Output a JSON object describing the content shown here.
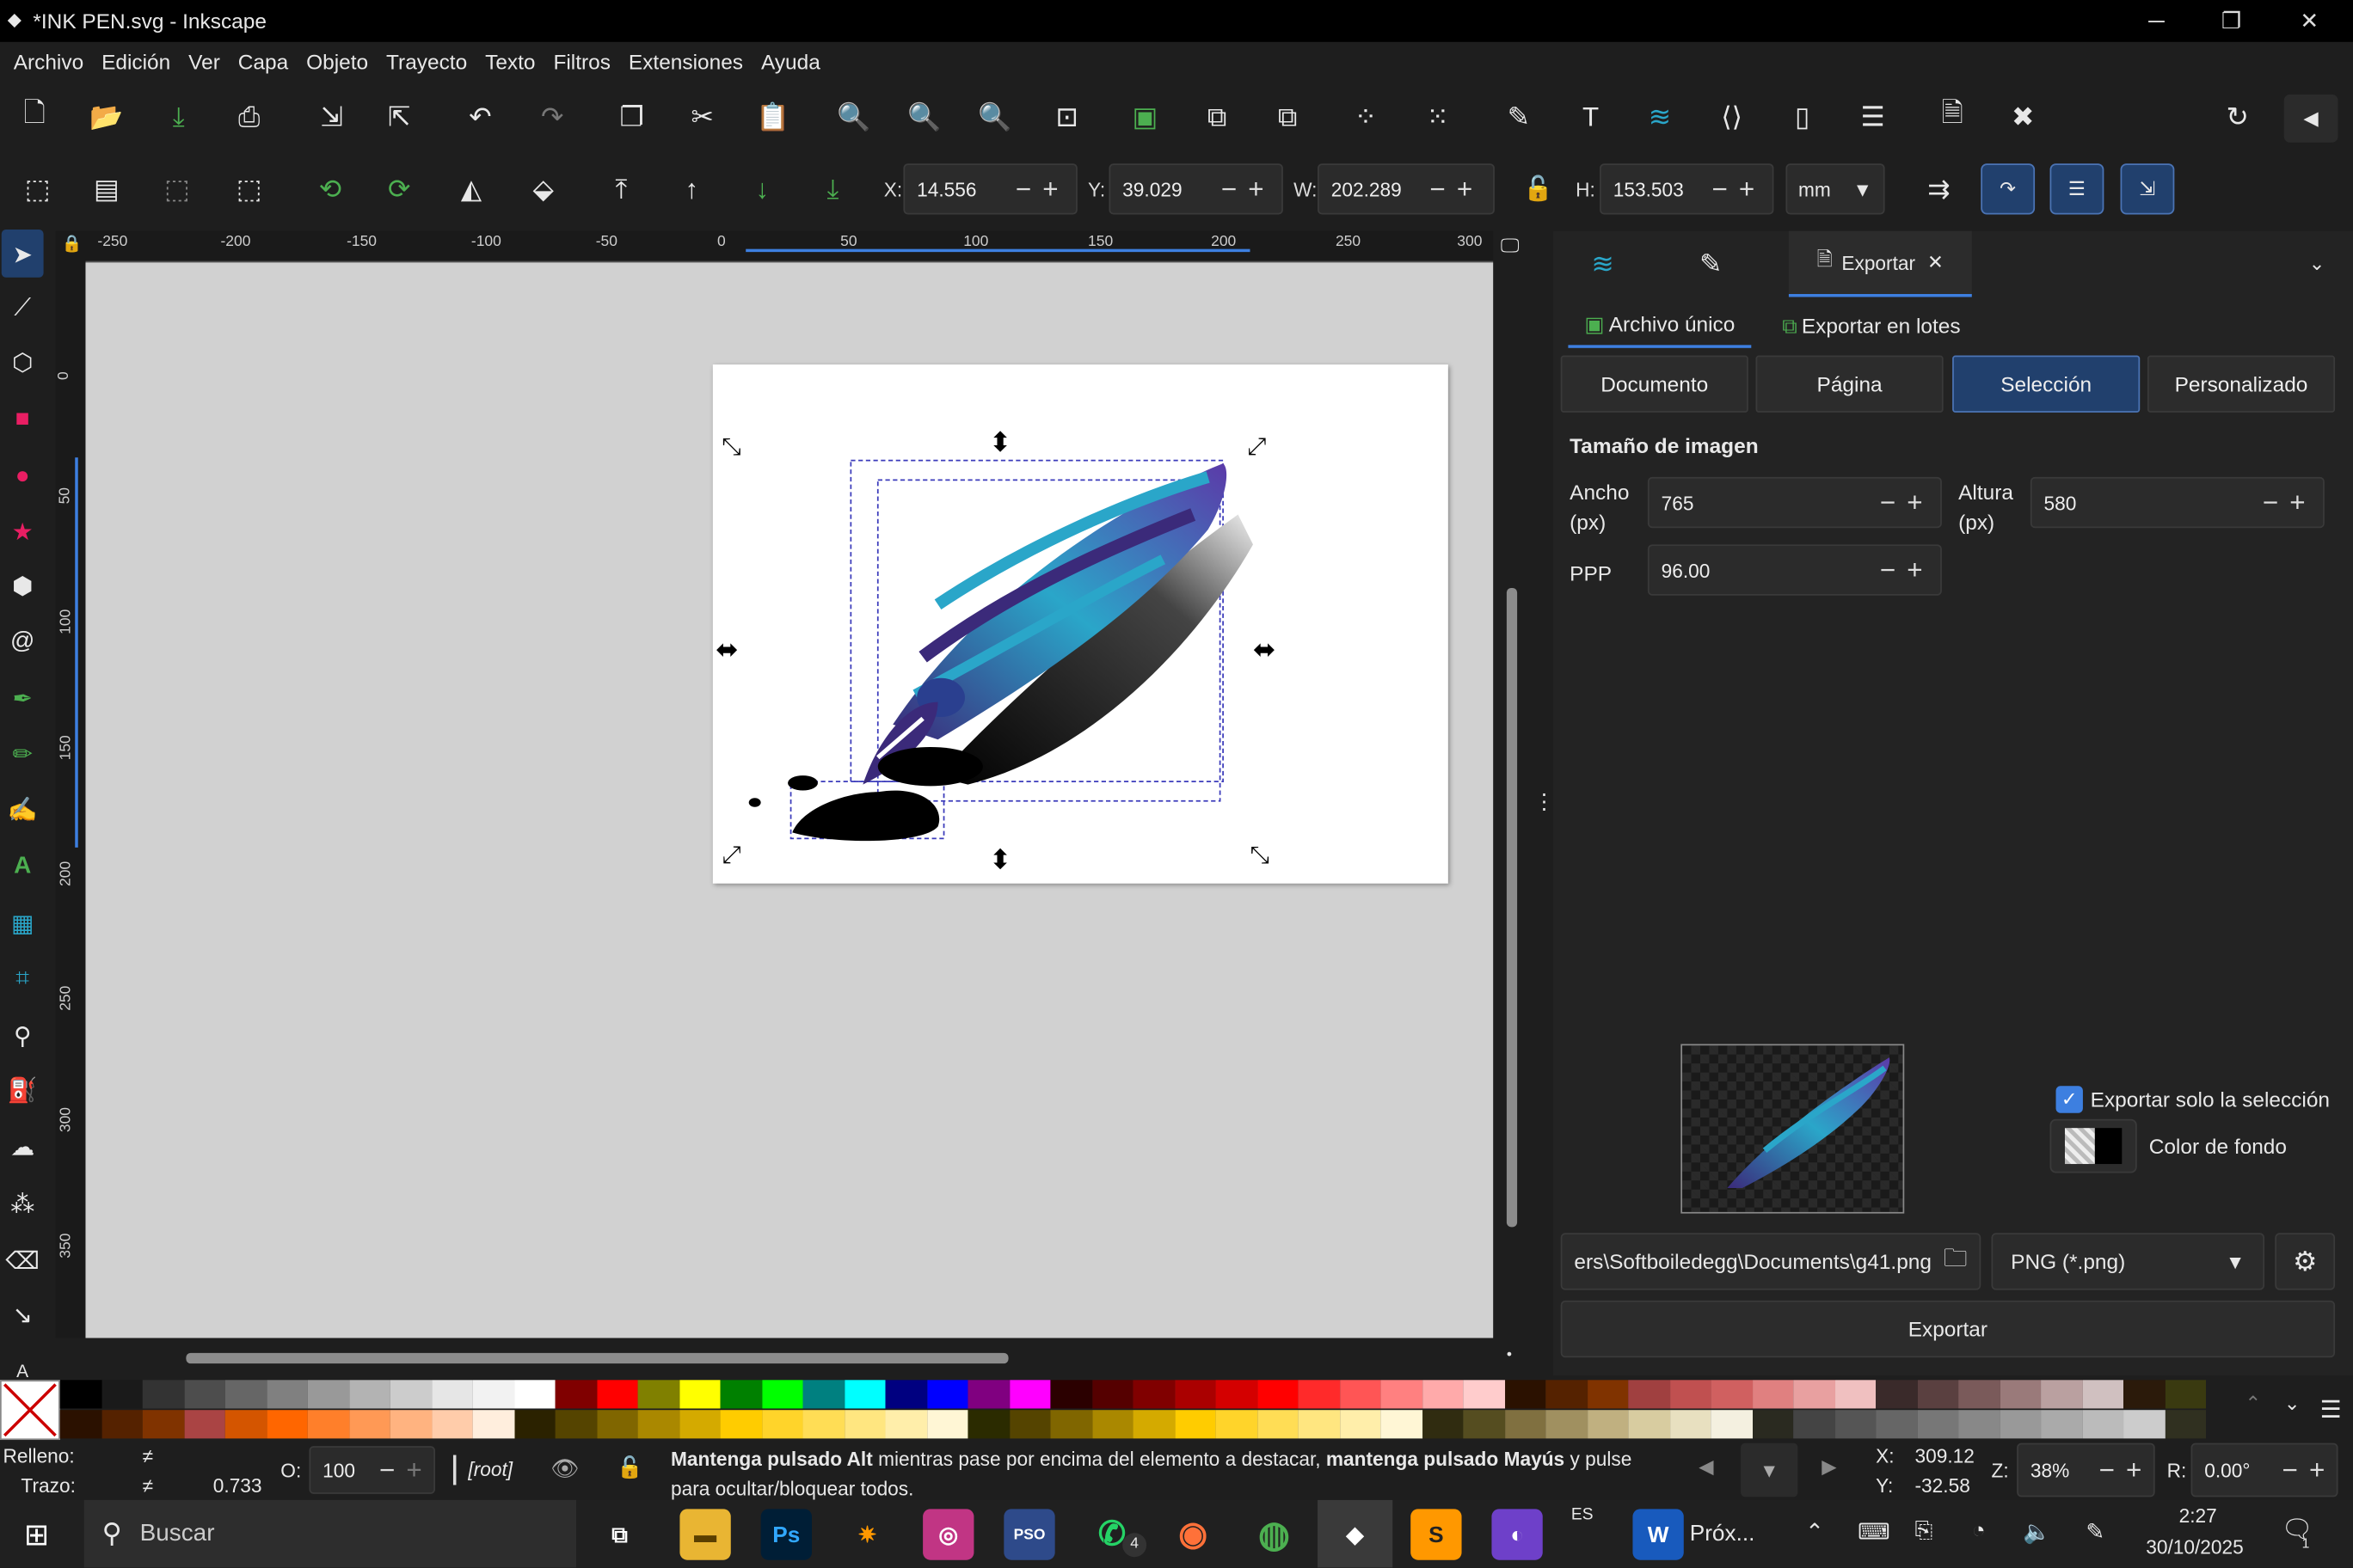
{
  "window": {
    "title": "*INK PEN.svg - Inkscape"
  },
  "menu": [
    "Archivo",
    "Edición",
    "Ver",
    "Capa",
    "Objeto",
    "Trayecto",
    "Texto",
    "Filtros",
    "Extensiones",
    "Ayuda"
  ],
  "coords": {
    "x_label": "X:",
    "x_value": "14.556",
    "y_label": "Y:",
    "y_value": "39.029",
    "w_label": "W:",
    "w_value": "202.289",
    "h_label": "H:",
    "h_value": "153.503",
    "unit": "mm"
  },
  "ruler_h": [
    "-250",
    "-200",
    "-150",
    "-100",
    "-50",
    "0",
    "50",
    "100",
    "150",
    "200",
    "250",
    "300"
  ],
  "ruler_v": [
    "0",
    "50",
    "100",
    "150",
    "200",
    "250",
    "300",
    "350"
  ],
  "panel": {
    "tab_export": "Exportar",
    "subtab_single": "Archivo único",
    "subtab_batch": "Exportar en lotes",
    "mode_buttons": [
      "Documento",
      "Página",
      "Selección",
      "Personalizado"
    ],
    "selected_mode": "Selección",
    "image_size_heading": "Tamaño de imagen",
    "width_label": "Ancho",
    "width_unit": "(px)",
    "width_value": "765",
    "height_label": "Altura",
    "height_unit": "(px)",
    "height_value": "580",
    "dpi_label": "PPP",
    "dpi_value": "96.00",
    "export_selection_only": "Exportar solo la selección",
    "background_color": "Color de fondo",
    "filename": "ers\\Softboiledegg\\Documents\\g41.png",
    "format": "PNG (*.png)",
    "export_button": "Exportar"
  },
  "status": {
    "fill_label": "Relleno:",
    "fill_value": "≠",
    "stroke_label": "Trazo:",
    "stroke_value": "≠",
    "stroke_width": "0.733",
    "opacity_label": "O:",
    "opacity_value": "100",
    "layer": "[root]",
    "hint_bold1": "Mantenga pulsado Alt",
    "hint_text1": " mientras pase por encima del elemento a destacar, ",
    "hint_bold2": "mantenga pulsado Mayús",
    "hint_text2": " y pulse",
    "hint_line2": "para ocultar/bloquear todos.",
    "cursor_x_label": "X:",
    "cursor_x": "309.12",
    "cursor_y_label": "Y:",
    "cursor_y": "-32.58",
    "zoom_label": "Z:",
    "zoom_value": "38%",
    "rotate_label": "R:",
    "rotate_value": "0.00°"
  },
  "taskbar": {
    "search_placeholder": "Buscar",
    "lang": "ES",
    "word_label": "Próx...",
    "time": "2:27",
    "date": "30/10/2025",
    "notification_count": "1",
    "whatsapp_badge": "4"
  },
  "colors": {
    "accent": "#21406d",
    "pen_teal": "#2aa6c9",
    "pen_purple": "#3b2a7a"
  }
}
